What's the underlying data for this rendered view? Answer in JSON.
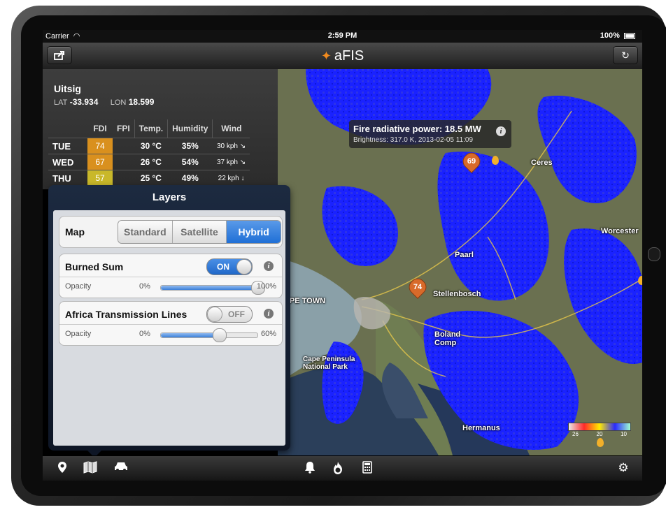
{
  "statusbar": {
    "carrier": "Carrier",
    "time": "2:59 PM",
    "battery": "100%"
  },
  "navbar": {
    "app_name": "aFIS",
    "share_icon": "share-icon",
    "refresh_icon": "refresh-icon"
  },
  "location": {
    "name": "Uitsig",
    "lat_label": "LAT",
    "lat": "-33.934",
    "lon_label": "LON",
    "lon": "18.599"
  },
  "weather": {
    "headers": [
      "FDI",
      "FPI",
      "Temp.",
      "Humidity",
      "Wind"
    ],
    "rows": [
      {
        "day": "TUE",
        "fdi": "74",
        "fdi_color": "#d9901e",
        "fpi": "",
        "temp": "30 °C",
        "humidity": "35%",
        "wind": "30 kph ↘"
      },
      {
        "day": "WED",
        "fdi": "67",
        "fdi_color": "#d9901e",
        "fpi": "",
        "temp": "26 °C",
        "humidity": "54%",
        "wind": "37 kph ↘"
      },
      {
        "day": "THU",
        "fdi": "57",
        "fdi_color": "#c9b82a",
        "fpi": "",
        "temp": "25 °C",
        "humidity": "49%",
        "wind": "22 kph ↓"
      }
    ]
  },
  "map": {
    "tooltip_title": "Fire radiative power: 18.5 MW",
    "tooltip_detail": "Brightness: 317.0 K, 2013-02-05 11:09",
    "pins": [
      "69",
      "74"
    ],
    "places": [
      "Ceres",
      "Worcester",
      "Paarl",
      "CAPE TOWN",
      "Stellenbosch",
      "Boland Comp",
      "Cape Peninsula National Park",
      "Hermanus"
    ],
    "legend_values": [
      "26",
      "20",
      "10"
    ]
  },
  "layers": {
    "title": "Layers",
    "map_label": "Map",
    "map_options": [
      "Standard",
      "Satellite",
      "Hybrid"
    ],
    "selected_map": "Hybrid",
    "items": [
      {
        "name": "Burned Sum",
        "switch": "ON",
        "opacity_label": "Opacity",
        "min": "0%",
        "max": "100%",
        "opacity": 1.0
      },
      {
        "name": "Africa Transmission Lines",
        "switch": "OFF",
        "opacity_label": "Opacity",
        "min": "0%",
        "max": "60%",
        "opacity": 0.6
      }
    ]
  },
  "toolbar": {
    "left": [
      "location-pin-icon",
      "map-icon",
      "car-icon"
    ],
    "center": [
      "bell-icon",
      "fire-icon",
      "calculator-icon"
    ],
    "right": [
      "gear-icon"
    ]
  },
  "colors": {
    "accent": "#1f6fd6",
    "burned_area": "#1a22ff",
    "pin": "#d86a2a"
  }
}
